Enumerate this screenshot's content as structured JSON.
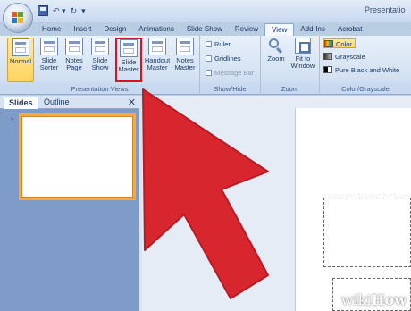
{
  "title_bar": {
    "title": "Presentatio"
  },
  "tabs": [
    "Home",
    "Insert",
    "Design",
    "Animations",
    "Slide Show",
    "Review",
    "View",
    "Add-Ins",
    "Acrobat"
  ],
  "active_tab": "View",
  "ribbon": {
    "presentation_views": {
      "label": "Presentation Views",
      "buttons": [
        {
          "line1": "Normal",
          "line2": ""
        },
        {
          "line1": "Slide",
          "line2": "Sorter"
        },
        {
          "line1": "Notes",
          "line2": "Page"
        },
        {
          "line1": "Slide",
          "line2": "Show"
        },
        {
          "line1": "Slide",
          "line2": "Master"
        },
        {
          "line1": "Handout",
          "line2": "Master"
        },
        {
          "line1": "Notes",
          "line2": "Master"
        }
      ]
    },
    "show_hide": {
      "label": "Show/Hide",
      "ruler": "Ruler",
      "gridlines": "Gridlines",
      "message_bar": "Message Bar"
    },
    "zoom": {
      "label": "Zoom",
      "zoom_btn": "Zoom",
      "fit_line1": "Fit to",
      "fit_line2": "Window"
    },
    "color_grayscale": {
      "label": "Color/Grayscale",
      "color": "Color",
      "grayscale": "Grayscale",
      "pure": "Pure Black and White"
    }
  },
  "left_pane": {
    "tab_slides": "Slides",
    "tab_outline": "Outline",
    "close": "✕",
    "slide_number": "1"
  },
  "watermark": {
    "wiki": "wiki",
    "how": "How"
  },
  "colors": {
    "arrow": "#d8262f",
    "highlight_box": "#d8121f",
    "thumb_selected": "#f5a945"
  }
}
